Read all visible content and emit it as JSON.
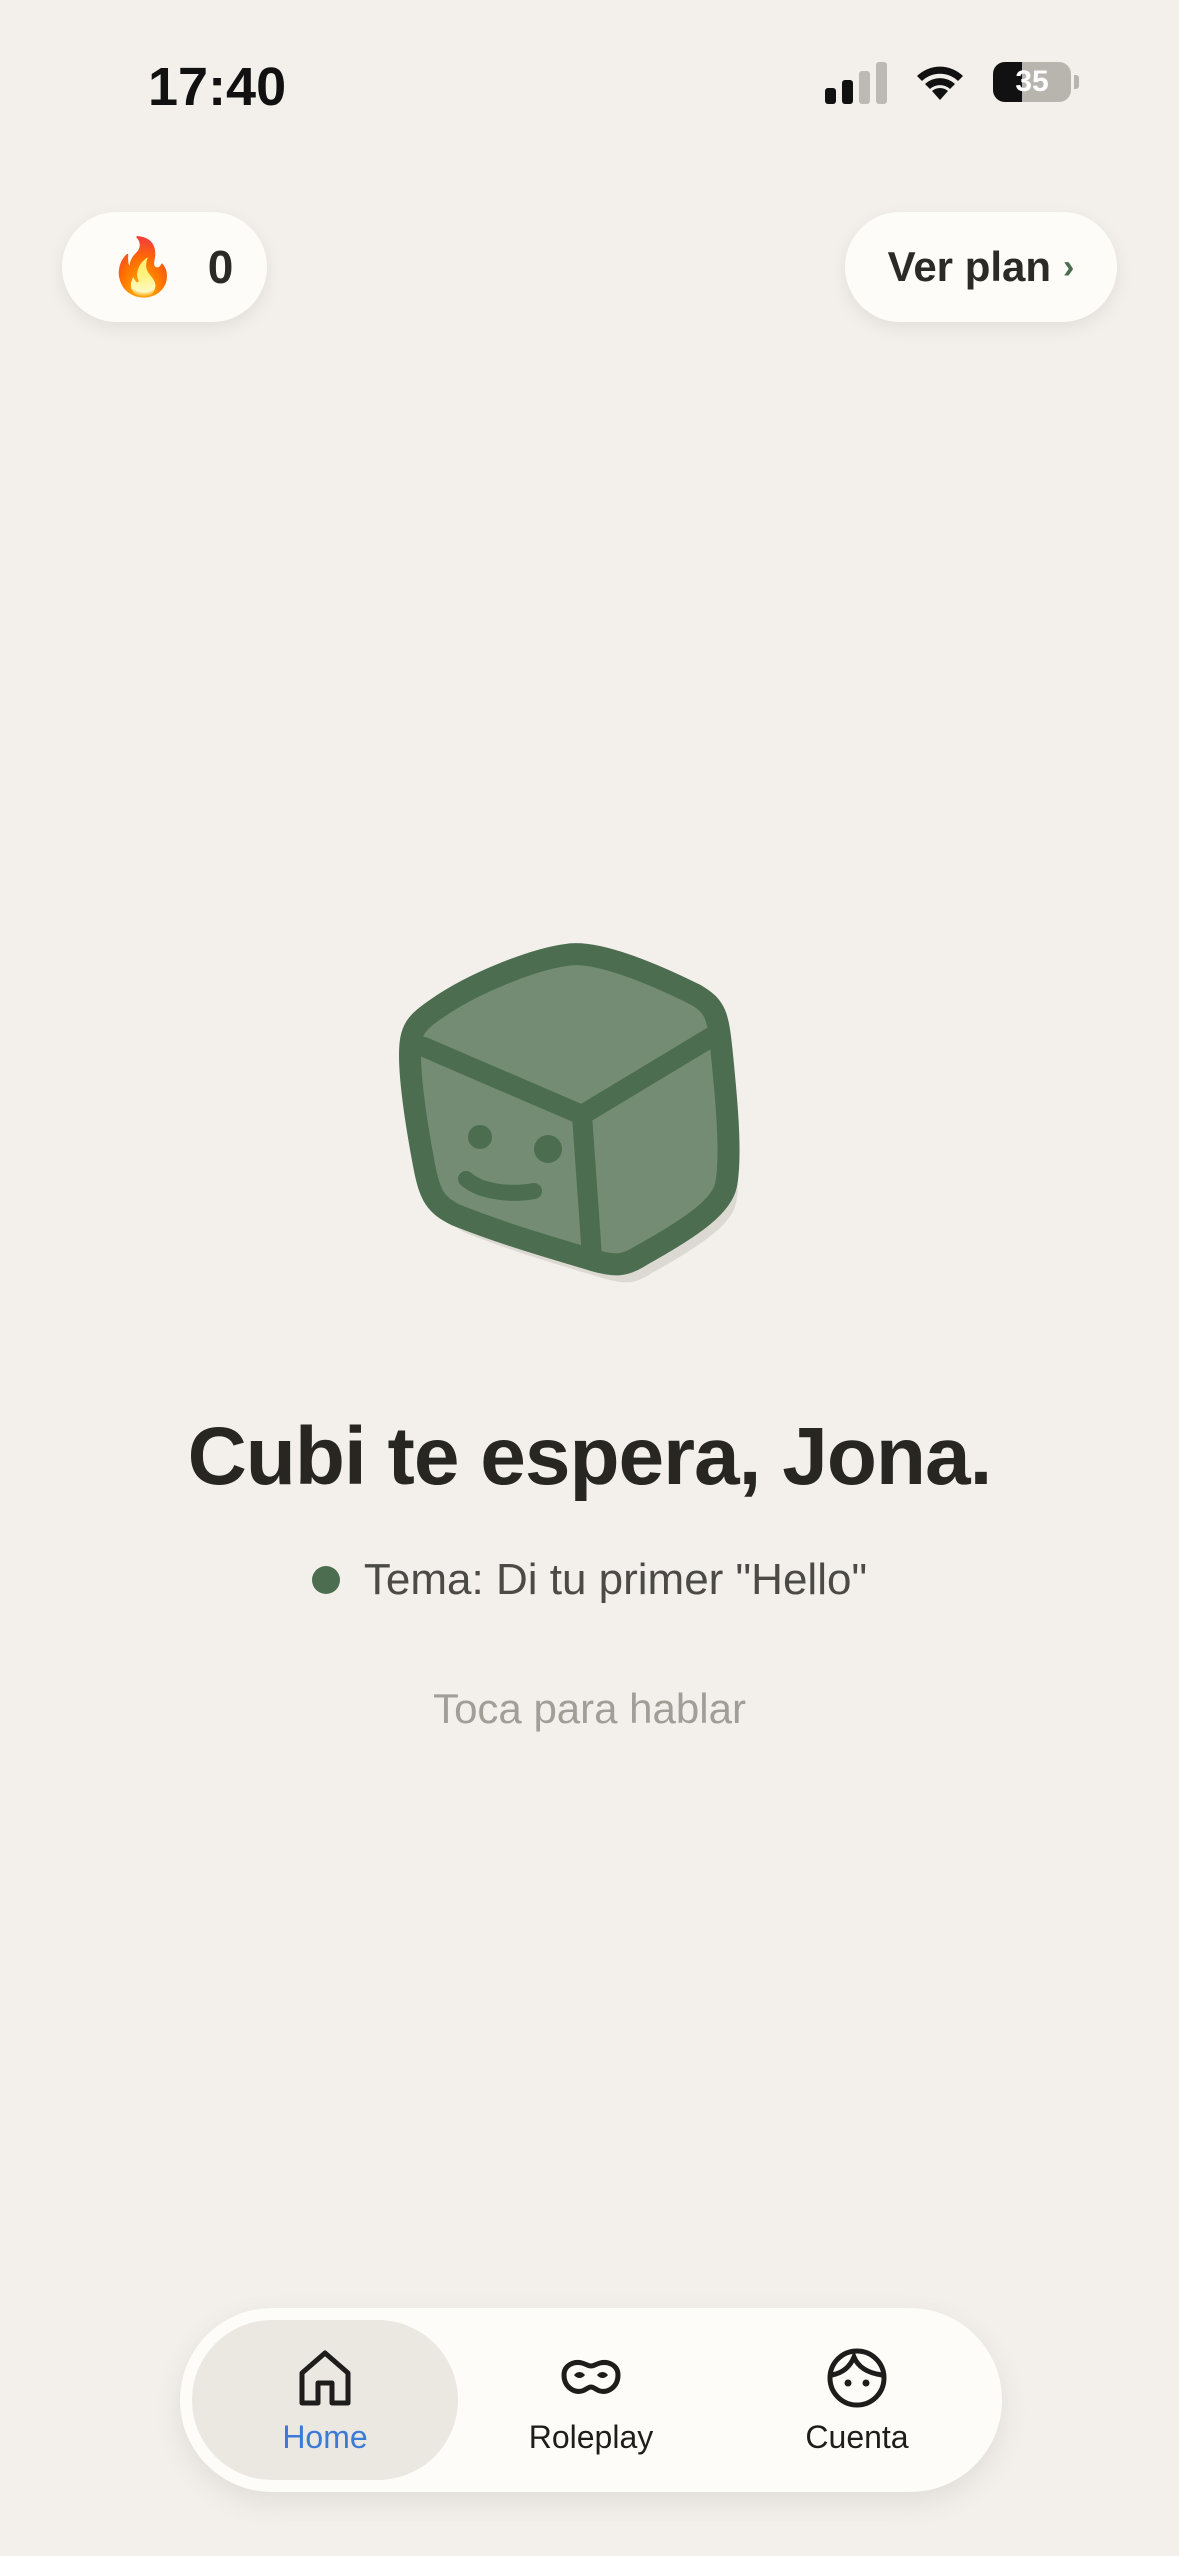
{
  "status_bar": {
    "time": "17:40",
    "battery_level": "35",
    "icons": [
      "cellular-signal-icon",
      "wifi-icon",
      "battery-icon"
    ]
  },
  "streak": {
    "icon": "fire-icon",
    "emoji": "🔥",
    "count": "0"
  },
  "plan_button": {
    "label": "Ver plan",
    "chevron": "›"
  },
  "main": {
    "mascot": "cube-mascot-icon",
    "title": "Cubi te espera, Jona.",
    "topic": "Tema: Di tu primer \"Hello\"",
    "hint": "Toca para hablar"
  },
  "tabs": [
    {
      "label": "Home",
      "icon": "home-icon",
      "active": true
    },
    {
      "label": "Roleplay",
      "icon": "mask-icon",
      "active": false
    },
    {
      "label": "Cuenta",
      "icon": "face-icon",
      "active": false
    }
  ],
  "colors": {
    "background": "#f3f0eb",
    "accent_green": "#4c6d4f",
    "cube_fill": "#738c73",
    "active_tab_blue": "#3b7ad6"
  }
}
